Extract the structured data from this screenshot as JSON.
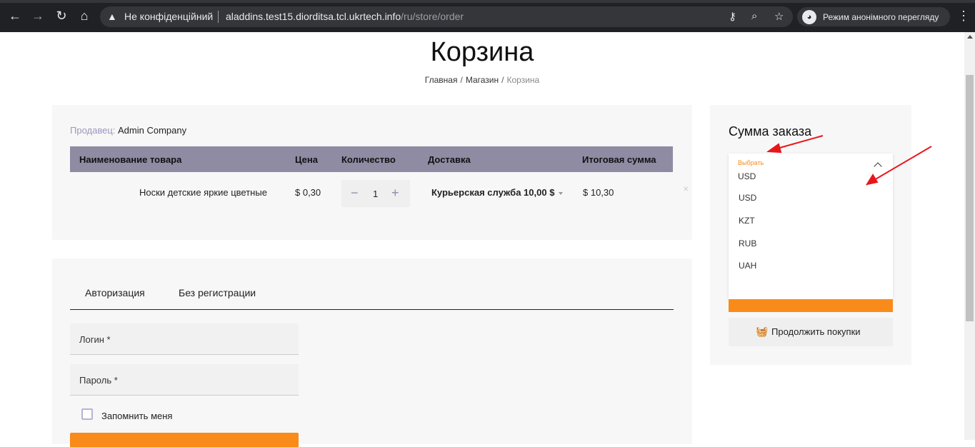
{
  "browser": {
    "security_text": "Не конфіденційний",
    "url_host": "aladdins.test15.diorditsa.tcl.ukrtech.info",
    "url_path": "/ru/store/order",
    "incognito_label": "Режим анонімного перегляду"
  },
  "page": {
    "title": "Корзина",
    "breadcrumb": [
      "Главная",
      "Магазин",
      "Корзина"
    ]
  },
  "cart": {
    "seller_label": "Продавец:",
    "seller_name": "Admin Company",
    "columns": [
      "Наименование товара",
      "Цена",
      "Количество",
      "Доставка",
      "Итоговая сумма"
    ],
    "item": {
      "name": "Носки детские яркие цветные",
      "price": "$ 0,30",
      "quantity": "1",
      "delivery": "Курьерская служба 10,00 $",
      "total": "$ 10,30"
    }
  },
  "auth": {
    "tabs": [
      "Авторизация",
      "Без регистрации"
    ],
    "login_placeholder": "Логин *",
    "password_placeholder": "Пароль *",
    "remember_label": "Запомнить меня"
  },
  "summary": {
    "title": "Сумма заказа",
    "currency_label": "Выбрать",
    "currency_selected": "USD",
    "currency_options": [
      "USD",
      "KZT",
      "RUB",
      "UAH"
    ],
    "continue_label": "Продолжить покупки"
  },
  "colors": {
    "accent": "#f98b1a",
    "table_header": "#8e8ba3",
    "annotation": "#e8161b"
  }
}
